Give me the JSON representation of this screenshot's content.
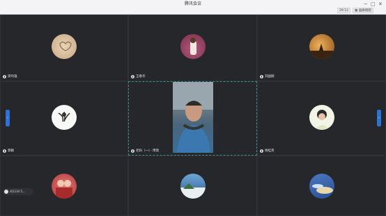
{
  "window": {
    "title": "腾讯会议",
    "controls": [
      "−",
      "□",
      "✕"
    ],
    "timer": "29:12",
    "gallery_label": "画廊视图"
  },
  "participants": [
    {
      "name": "梁均强"
    },
    {
      "name": "王春华"
    },
    {
      "name": "刘国刚"
    },
    {
      "name": "郭颖"
    },
    {
      "name": "老妈（一)  · 用我"
    },
    {
      "name": "杨桂英"
    },
    {
      "name": ""
    },
    {
      "name": ""
    },
    {
      "name": ""
    }
  ],
  "toast": {
    "text": "刘1234 5..."
  },
  "nav": {
    "left": "‹",
    "right": "›"
  },
  "colors": {
    "accent": "#2e6fd8",
    "speaker_border": "#3a8f86"
  }
}
